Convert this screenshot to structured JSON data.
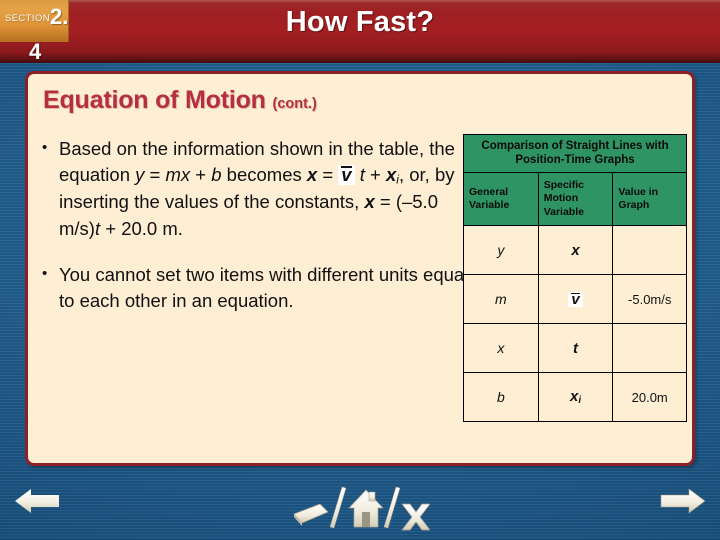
{
  "header": {
    "section_word": "SECTION",
    "section_number_major": "2.",
    "section_number_minor": "4",
    "title": "How Fast?"
  },
  "content": {
    "heading_main": "Equation of Motion",
    "heading_suffix": "(cont.)",
    "bullets": [
      {
        "marker": "•",
        "segments": [
          {
            "text": "Based on the information shown in the table, the equation ",
            "style": "plain"
          },
          {
            "text": "y",
            "style": "italic"
          },
          {
            "text": " = ",
            "style": "plain"
          },
          {
            "text": "mx",
            "style": "italic"
          },
          {
            "text": " + ",
            "style": "plain"
          },
          {
            "text": "b",
            "style": "italic"
          },
          {
            "text": " becomes ",
            "style": "plain"
          },
          {
            "text": "x",
            "style": "bold-italic"
          },
          {
            "text": " = ",
            "style": "plain"
          },
          {
            "text": "v",
            "style": "vbar-box"
          },
          {
            "text": " ",
            "style": "plain"
          },
          {
            "text": "t",
            "style": "italic"
          },
          {
            "text": " + ",
            "style": "plain"
          },
          {
            "text": "x",
            "style": "bold-italic"
          },
          {
            "text": "i",
            "style": "subscript"
          },
          {
            "text": ", or, by inserting the values of the constants, ",
            "style": "plain"
          },
          {
            "text": "x",
            "style": "bold-italic"
          },
          {
            "text": " = (–5.0 m/s)",
            "style": "plain"
          },
          {
            "text": "t",
            "style": "italic"
          },
          {
            "text": " + 20.0 m.",
            "style": "plain"
          }
        ]
      },
      {
        "marker": "•",
        "segments": [
          {
            "text": "You cannot set two items with different units equal to each other in an equation.",
            "style": "plain"
          }
        ]
      }
    ]
  },
  "table": {
    "title": "Comparison of Straight Lines with Position-Time Graphs",
    "columns": [
      "General Variable",
      "Specific Motion Variable",
      "Value in Graph"
    ],
    "rows": [
      {
        "general": "y",
        "specific": "x",
        "specific_style": "bold-italic",
        "value": ""
      },
      {
        "general": "m",
        "specific": "v",
        "specific_style": "vbar-box",
        "value": "-5.0m/s"
      },
      {
        "general": "x",
        "specific": "t",
        "specific_style": "bold-italic",
        "value": ""
      },
      {
        "general": "b",
        "specific": "x",
        "specific_style": "bold-italic-sub",
        "specific_sub": "i",
        "value": "20.0m"
      }
    ]
  },
  "navigation": {
    "prev_label": "Previous slide",
    "next_label": "Next slide",
    "resource_label": "Resources",
    "home_label": "Home",
    "exit_label": "Exit"
  },
  "colors": {
    "slide_blue": "#1d5a8c",
    "title_red": "#9e1f22",
    "badge_orange": "#dd9236",
    "panel_cream": "#fdeed4",
    "panel_border": "#8c2029",
    "heading_crimson": "#b52f40",
    "table_green": "#2f9463"
  }
}
